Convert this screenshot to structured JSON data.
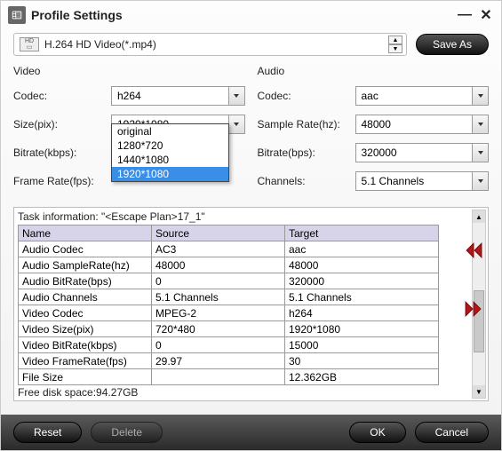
{
  "title": "Profile Settings",
  "profile": {
    "selected": "H.264 HD Video(*.mp4)",
    "icon_label": "HD"
  },
  "save_as_label": "Save As",
  "video": {
    "section": "Video",
    "codec_label": "Codec:",
    "codec_value": "h264",
    "size_label": "Size(pix):",
    "size_value": "1920*1080",
    "size_options": [
      "original",
      "1280*720",
      "1440*1080",
      "1920*1080"
    ],
    "bitrate_label": "Bitrate(kbps):",
    "framerate_label": "Frame Rate(fps):"
  },
  "audio": {
    "section": "Audio",
    "codec_label": "Codec:",
    "codec_value": "aac",
    "samplerate_label": "Sample Rate(hz):",
    "samplerate_value": "48000",
    "bitrate_label": "Bitrate(bps):",
    "bitrate_value": "320000",
    "channels_label": "Channels:",
    "channels_value": "5.1 Channels"
  },
  "task": {
    "title": "Task information: \"<Escape Plan>17_1\"",
    "headers": [
      "Name",
      "Source",
      "Target"
    ],
    "rows": [
      [
        "Audio Codec",
        "AC3",
        "aac"
      ],
      [
        "Audio SampleRate(hz)",
        "48000",
        "48000"
      ],
      [
        "Audio BitRate(bps)",
        "0",
        "320000"
      ],
      [
        "Audio Channels",
        "5.1 Channels",
        "5.1 Channels"
      ],
      [
        "Video Codec",
        "MPEG-2",
        "h264"
      ],
      [
        "Video Size(pix)",
        "720*480",
        "1920*1080"
      ],
      [
        "Video BitRate(kbps)",
        "0",
        "15000"
      ],
      [
        "Video FrameRate(fps)",
        "29.97",
        "30"
      ],
      [
        "File Size",
        "",
        "12.362GB"
      ]
    ],
    "free_disk": "Free disk space:94.27GB"
  },
  "buttons": {
    "reset": "Reset",
    "delete": "Delete",
    "ok": "OK",
    "cancel": "Cancel"
  }
}
